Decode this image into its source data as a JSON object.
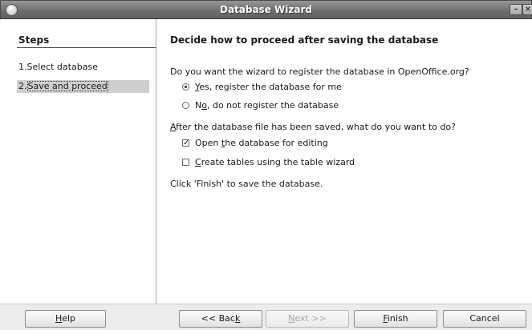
{
  "window": {
    "title": "Database Wizard",
    "minimize_glyph": "–",
    "close_glyph": "×",
    "app_icon": "app-icon"
  },
  "sidebar": {
    "heading": "Steps",
    "steps": [
      {
        "num": "1.",
        "label": "Select database"
      },
      {
        "num": "2.",
        "label": "Save and proceed"
      }
    ]
  },
  "content": {
    "title": "Decide how to proceed after saving the database",
    "register_question": "Do you want the wizard to register the database in OpenOffice.org?",
    "register_yes": {
      "pre": "",
      "key": "Y",
      "post": "es, register the database for me",
      "checked": true
    },
    "register_no": {
      "pre": "N",
      "key": "o",
      "post": ", do not register the database",
      "checked": false
    },
    "after_question": {
      "pre": "",
      "key": "A",
      "post": "fter the database file has been saved, what do you want to do?"
    },
    "open_edit": {
      "pre": "Open ",
      "key": "t",
      "post": "he database for editing",
      "checked": true
    },
    "create_tables": {
      "pre": "",
      "key": "C",
      "post": "reate tables using the table wizard",
      "checked": false
    },
    "finish_note": "Click 'Finish' to save the database."
  },
  "buttons": {
    "help": {
      "pre": "",
      "key": "H",
      "post": "elp"
    },
    "back": {
      "pre": "<< Bac",
      "key": "k",
      "post": ""
    },
    "next": {
      "pre": "",
      "key": "N",
      "post": "ext >>",
      "enabled": false
    },
    "finish": {
      "pre": "",
      "key": "F",
      "post": "inish"
    },
    "cancel": "Cancel"
  }
}
